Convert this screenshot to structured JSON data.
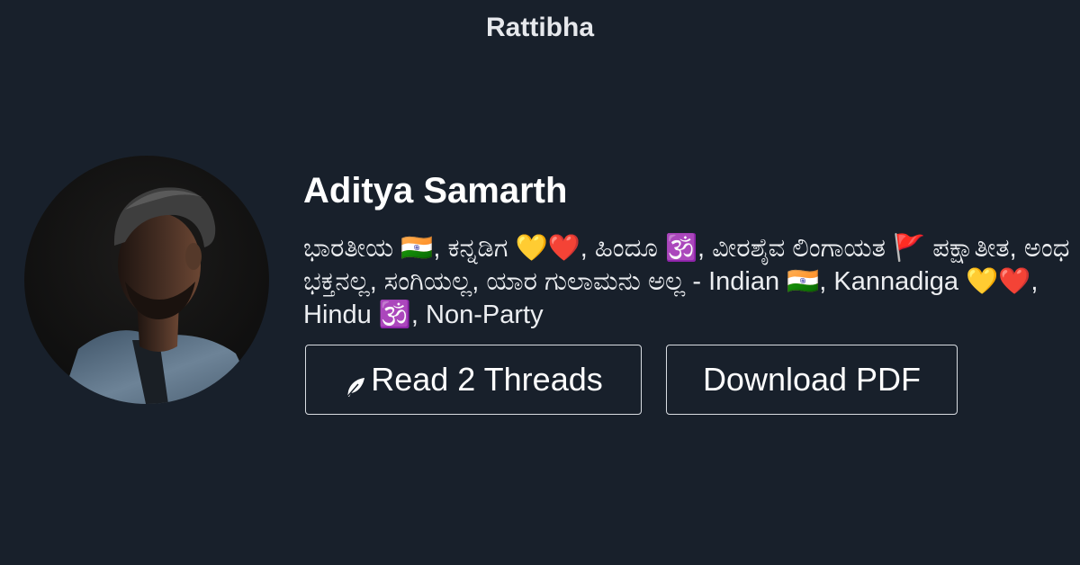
{
  "brand": {
    "title": "Rattibha"
  },
  "profile": {
    "name": "Aditya Samarth",
    "bio": "ಭಾರತೀಯ 🇮🇳, ಕನ್ನಡಿಗ 💛❤️, ಹಿಂದೂ 🕉️, ವೀರಶೈವ ಲಿಂಗಾಯತ 🚩 ಪಕ್ಷಾತೀತ, ಅಂಧ ಭಕ್ತನಲ್ಲ, ಸಂಗಿಯಲ್ಲ, ಯಾರ ಗುಲಾಮನು ಅಲ್ಲ - Indian 🇮🇳, Kannadiga 💛❤️, Hindu 🕉️, Non-Party",
    "avatar_icon": "user-photo"
  },
  "actions": {
    "read_threads_label": "Read 2 Threads",
    "read_threads_icon": "feather-icon",
    "download_pdf_label": "Download PDF"
  },
  "colors": {
    "background": "#18202b",
    "text": "#ffffff",
    "button_border": "#d9dde2"
  }
}
